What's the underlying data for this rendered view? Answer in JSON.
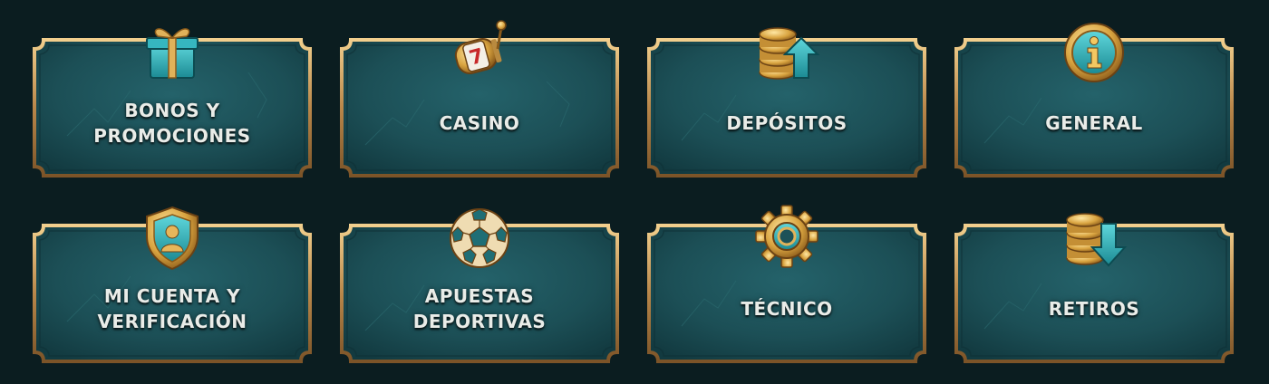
{
  "colors": {
    "background": "#0b1d20",
    "panel": "#1d5258",
    "frame_gold": "#c9995a",
    "text": "#e9ece8"
  },
  "categories": [
    {
      "label": "BONOS Y\nPROMOCIONES",
      "icon": "gift-icon"
    },
    {
      "label": "CASINO",
      "icon": "slot-reel-icon"
    },
    {
      "label": "DEPÓSITOS",
      "icon": "coins-up-arrow-icon"
    },
    {
      "label": "GENERAL",
      "icon": "info-icon"
    },
    {
      "label": "MI CUENTA Y\nVERIFICACIÓN",
      "icon": "shield-user-icon"
    },
    {
      "label": "APUESTAS\nDEPORTIVAS",
      "icon": "soccer-ball-icon"
    },
    {
      "label": "TÉCNICO",
      "icon": "gear-icon"
    },
    {
      "label": "RETIROS",
      "icon": "coins-down-arrow-icon"
    }
  ]
}
